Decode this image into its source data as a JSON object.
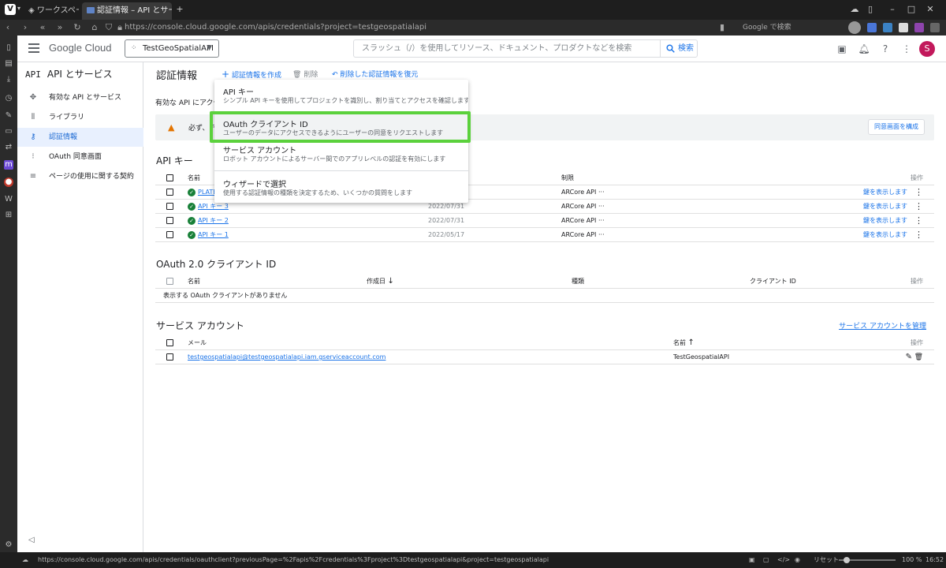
{
  "browser": {
    "tabs": [
      {
        "label": "ワークスペース"
      },
      {
        "label": "認証情報 – API とサービス – Te"
      }
    ],
    "url": "https://console.cloud.google.com/apis/credentials?project=testgeospatialapi",
    "search_placeholder": "Google で検索",
    "status_url": "https://console.cloud.google.com/apis/credentials/oauthclient?previousPage=%2Fapis%2Fcredentials%3Fproject%3Dtestgeospatialapi&project=testgeospatialapi",
    "reset_label": "リセット",
    "zoom": "100 %",
    "clock": "16:52"
  },
  "header": {
    "logo_google": "Google",
    "logo_cloud": "Cloud",
    "project": "TestGeoSpatialAPI",
    "search_placeholder": "スラッシュ（/）を使用してリソース、ドキュメント、プロダクトなどを検索",
    "search_button": "検索",
    "avatar_letter": "S",
    "avatar_color": "#c2185b"
  },
  "sidenav": {
    "badge": "API",
    "title": "API とサービス",
    "items": [
      {
        "label": "有効な API とサービス",
        "icon": "grid-icon"
      },
      {
        "label": "ライブラリ",
        "icon": "library-icon"
      },
      {
        "label": "認証情報",
        "icon": "key-icon",
        "active": true
      },
      {
        "label": "OAuth 同意画面",
        "icon": "consent-icon"
      },
      {
        "label": "ページの使用に関する契約",
        "icon": "settings-list-icon"
      }
    ],
    "collapse": "◁"
  },
  "main": {
    "title": "認証情報",
    "actions": {
      "create": "認証情報を作成",
      "delete": "削除",
      "restore": "削除した認証情報を復元"
    },
    "description": "有効な API にアクセ",
    "warning": "必ず、ア",
    "consent_button": "同意画面を構成"
  },
  "api_keys": {
    "title": "API キー",
    "headers": {
      "name": "名前",
      "restriction": "制限",
      "actions": "操作"
    },
    "rows": [
      {
        "name": "PLATE",
        "date": "",
        "restriction": "ARCore API",
        "show": "鍵を表示します"
      },
      {
        "name": "API キー 3",
        "date": "2022/07/31",
        "restriction": "ARCore API",
        "show": "鍵を表示します"
      },
      {
        "name": "API キー 2",
        "date": "2022/07/31",
        "restriction": "ARCore API",
        "show": "鍵を表示します"
      },
      {
        "name": "API キー 1",
        "date": "2022/05/17",
        "restriction": "ARCore API",
        "show": "鍵を表示します"
      }
    ]
  },
  "oauth": {
    "title": "OAuth 2.0 クライアント ID",
    "headers": {
      "name": "名前",
      "created": "作成日",
      "type": "種類",
      "client_id": "クライアント ID",
      "actions": "操作"
    },
    "empty": "表示する OAuth クライアントがありません"
  },
  "service_accounts": {
    "title": "サービス アカウント",
    "manage_link": "サービス アカウントを管理",
    "headers": {
      "email": "メール",
      "name": "名前",
      "actions": "操作"
    },
    "rows": [
      {
        "email": "testgeospatialapi@testgeospatialapi.iam.gserviceaccount.com",
        "name": "TestGeospatialAPI"
      }
    ]
  },
  "dropdown": {
    "items": [
      {
        "title": "API キー",
        "desc": "シンプル API キーを使用してプロジェクトを識別し、割り当てとアクセスを確認します"
      },
      {
        "title": "OAuth クライアント ID",
        "desc": "ユーザーのデータにアクセスできるようにユーザーの同意をリクエストします"
      },
      {
        "title": "サービス アカウント",
        "desc": "ロボット アカウントによるサーバー間でのアプリレベルの認証を有効にします"
      },
      {
        "title": "ウィザードで選択",
        "desc": "使用する認証情報の種類を決定するため、いくつかの質問をします"
      }
    ],
    "highlight_color": "#5bd13c"
  }
}
